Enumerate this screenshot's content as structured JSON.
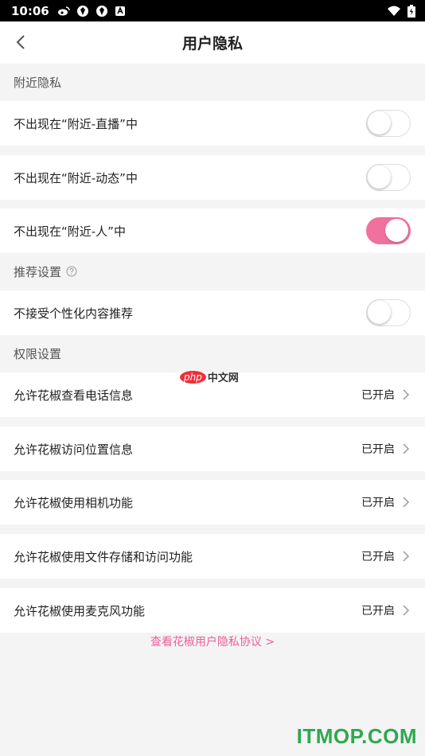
{
  "status_bar": {
    "time": "10:06",
    "icons_left": [
      "weibo-icon",
      "app-icon",
      "app-icon",
      "notification-icon"
    ],
    "icons_right": [
      "wifi-icon",
      "battery-icon"
    ]
  },
  "nav": {
    "title": "用户隐私"
  },
  "sections": {
    "nearby": {
      "header": "附近隐私"
    },
    "recommend": {
      "header": "推荐设置"
    },
    "permission": {
      "header": "权限设置"
    }
  },
  "toggles": [
    {
      "label": "不出现在“附近-直播”中",
      "on": false
    },
    {
      "label": "不出现在“附近-动态”中",
      "on": false
    },
    {
      "label": "不出现在“附近-人”中",
      "on": true
    },
    {
      "label": "不接受个性化内容推荐",
      "on": false
    }
  ],
  "permissions": [
    {
      "label": "允许花椒查看电话信息",
      "status": "已开启"
    },
    {
      "label": "允许花椒访问位置信息",
      "status": "已开启"
    },
    {
      "label": "允许花椒使用相机功能",
      "status": "已开启"
    },
    {
      "label": "允许花椒使用文件存储和访问功能",
      "status": "已开启"
    },
    {
      "label": "允许花椒使用麦克风功能",
      "status": "已开启"
    }
  ],
  "footer_link": "查看花椒用户隐私协议 >",
  "watermarks": {
    "php_badge": "php",
    "php_text": "中文网",
    "site": "ITMOP.COM"
  },
  "colors": {
    "accent": "#f0709e",
    "link": "#ee5d99",
    "watermark_green": "#2fa84f"
  }
}
